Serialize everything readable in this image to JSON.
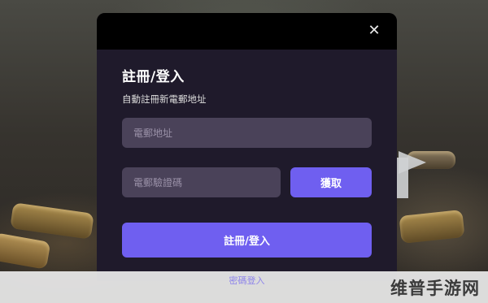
{
  "modal": {
    "close_icon": "close-icon",
    "title": "註冊/登入",
    "subtitle": "自動註冊新電郵地址",
    "email": {
      "placeholder": "電郵地址",
      "value": ""
    },
    "code": {
      "placeholder": "電郵驗證碼",
      "value": ""
    },
    "get_code_label": "獲取",
    "submit_label": "註冊/登入",
    "password_login_label": "密碼登入"
  },
  "watermark": "维普手游网",
  "colors": {
    "accent": "#6f5ff0",
    "modal_bg": "#1f1a2b",
    "input_bg": "#4a4259",
    "link": "#8e84ea"
  }
}
